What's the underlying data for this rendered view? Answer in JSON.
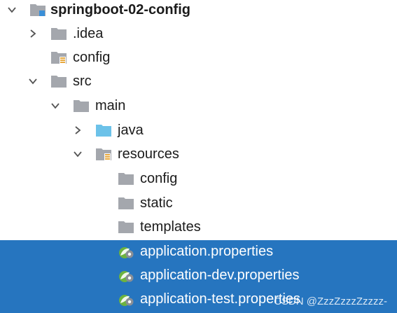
{
  "tree": {
    "root": {
      "label": "springboot-02-config",
      "icon": "module-folder-icon"
    },
    "idea": {
      "label": ".idea",
      "icon": "folder-icon"
    },
    "config_root": {
      "label": "config",
      "icon": "resources-folder-icon"
    },
    "src": {
      "label": "src",
      "icon": "folder-icon"
    },
    "main": {
      "label": "main",
      "icon": "folder-icon"
    },
    "java": {
      "label": "java",
      "icon": "source-folder-icon"
    },
    "resources": {
      "label": "resources",
      "icon": "resources-folder-icon"
    },
    "config": {
      "label": "config",
      "icon": "folder-icon"
    },
    "static": {
      "label": "static",
      "icon": "folder-icon"
    },
    "templates": {
      "label": "templates",
      "icon": "folder-icon"
    },
    "app_props": {
      "label": "application.properties",
      "icon": "spring-properties-icon"
    },
    "app_dev_props": {
      "label": "application-dev.properties",
      "icon": "spring-properties-icon"
    },
    "app_test_props": {
      "label": "application-test.properties",
      "icon": "spring-properties-icon"
    }
  },
  "watermark": "CSDN @ZzzZzzzZzzzz-",
  "colors": {
    "selection": "#2675bf",
    "folder": "#a4a7ad",
    "source_folder": "#6cc2e9",
    "resources_bar": "#e7a83d",
    "spring_green": "#6db33f"
  }
}
